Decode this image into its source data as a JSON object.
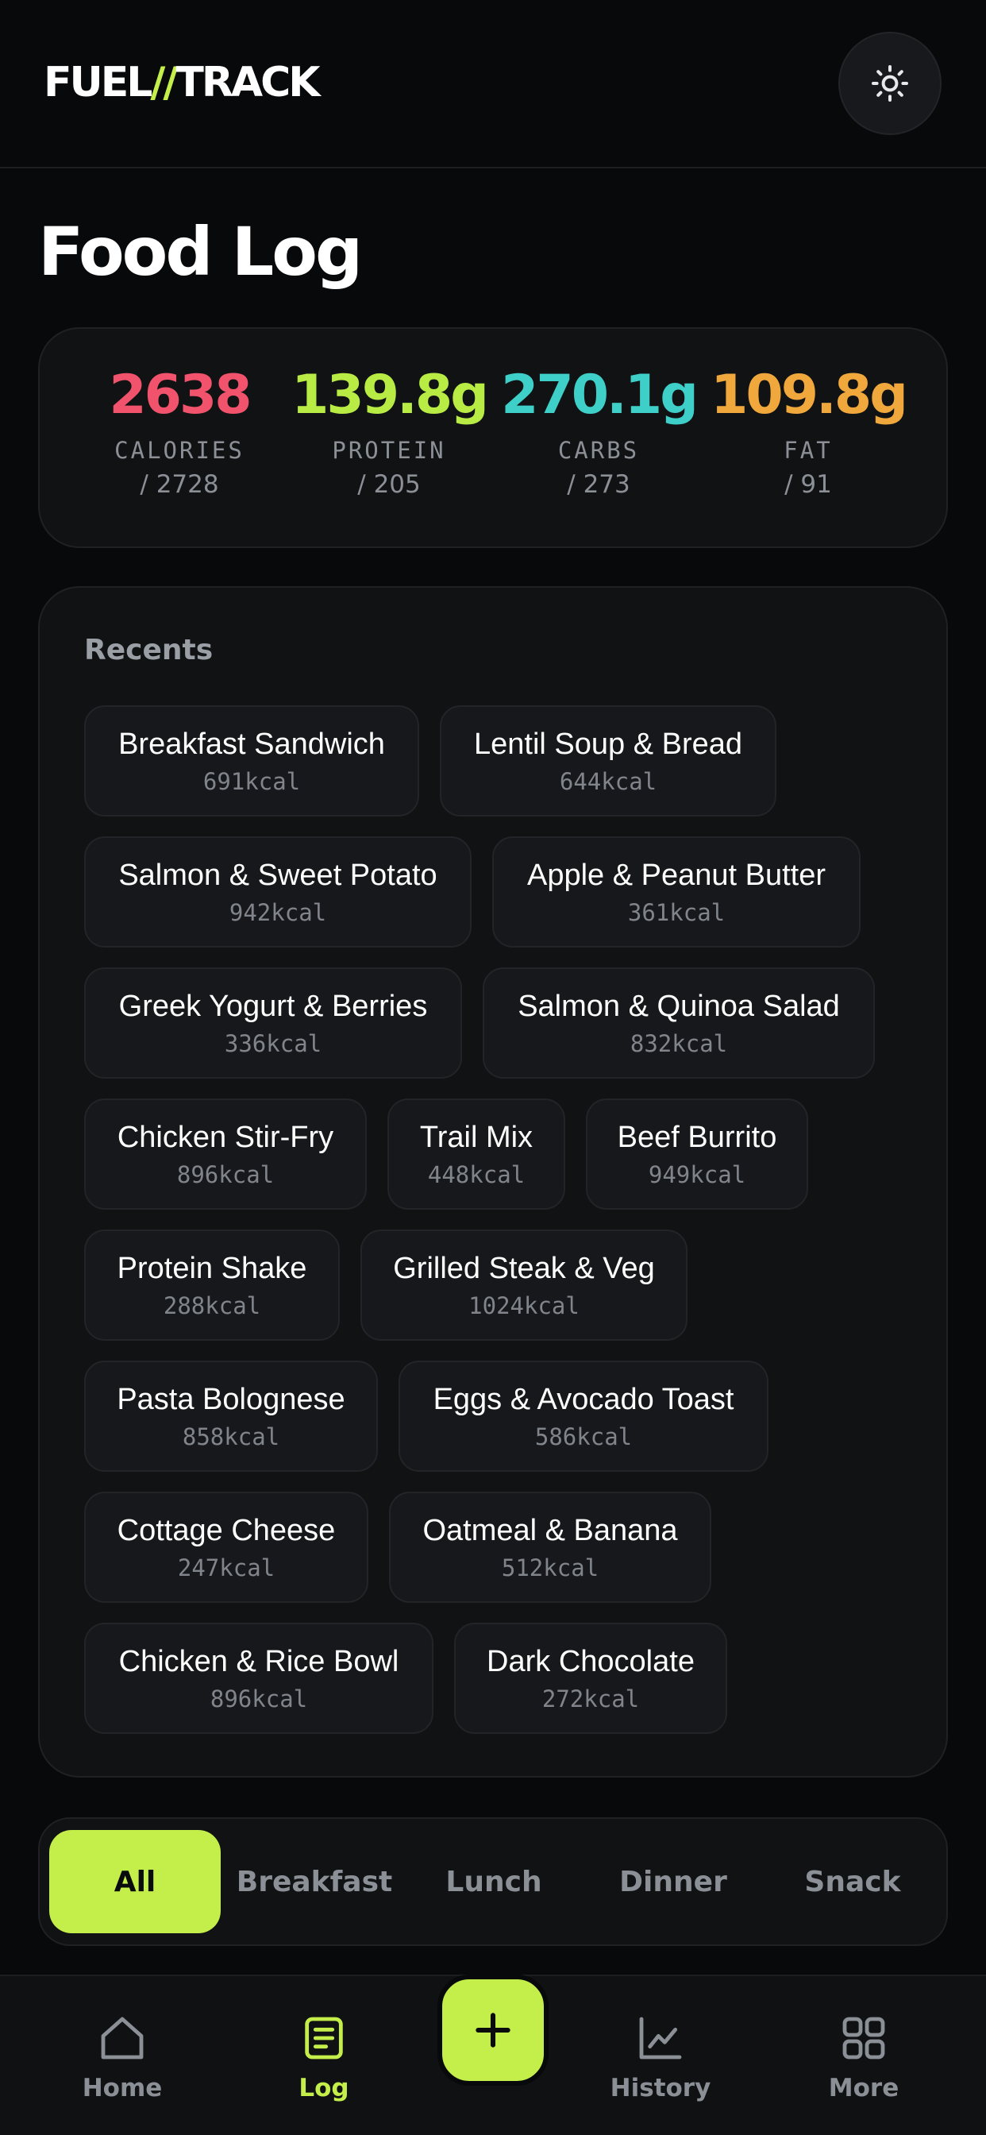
{
  "header": {
    "logo_left": "FUEL",
    "logo_slash": "//",
    "logo_right": "TRACK",
    "theme_icon": "sun-icon"
  },
  "page_title": "Food Log",
  "summary": [
    {
      "value": "2638",
      "label": "CALORIES",
      "goal": "/ 2728",
      "color": "#f0536b"
    },
    {
      "value": "139.8g",
      "label": "PROTEIN",
      "goal": "/ 205",
      "color": "#b8ec45"
    },
    {
      "value": "270.1g",
      "label": "CARBS",
      "goal": "/ 273",
      "color": "#3ed0c8"
    },
    {
      "value": "109.8g",
      "label": "FAT",
      "goal": "/ 91",
      "color": "#f0a73c"
    }
  ],
  "recents": {
    "title": "Recents",
    "items": [
      {
        "name": "Breakfast Sandwich",
        "kcal": "691kcal"
      },
      {
        "name": "Lentil Soup & Bread",
        "kcal": "644kcal"
      },
      {
        "name": "Salmon & Sweet Potato",
        "kcal": "942kcal"
      },
      {
        "name": "Apple & Peanut Butter",
        "kcal": "361kcal"
      },
      {
        "name": "Greek Yogurt & Berries",
        "kcal": "336kcal"
      },
      {
        "name": "Salmon & Quinoa Salad",
        "kcal": "832kcal"
      },
      {
        "name": "Chicken Stir-Fry",
        "kcal": "896kcal"
      },
      {
        "name": "Trail Mix",
        "kcal": "448kcal"
      },
      {
        "name": "Beef Burrito",
        "kcal": "949kcal"
      },
      {
        "name": "Protein Shake",
        "kcal": "288kcal"
      },
      {
        "name": "Grilled Steak & Veg",
        "kcal": "1024kcal"
      },
      {
        "name": "Pasta Bolognese",
        "kcal": "858kcal"
      },
      {
        "name": "Eggs & Avocado Toast",
        "kcal": "586kcal"
      },
      {
        "name": "Cottage Cheese",
        "kcal": "247kcal"
      },
      {
        "name": "Oatmeal & Banana",
        "kcal": "512kcal"
      },
      {
        "name": "Chicken & Rice Bowl",
        "kcal": "896kcal"
      },
      {
        "name": "Dark Chocolate",
        "kcal": "272kcal"
      }
    ]
  },
  "meal_tabs": [
    {
      "label": "All",
      "active": true
    },
    {
      "label": "Breakfast",
      "active": false
    },
    {
      "label": "Lunch",
      "active": false
    },
    {
      "label": "Dinner",
      "active": false
    },
    {
      "label": "Snack",
      "active": false
    }
  ],
  "nav": {
    "home": "Home",
    "log": "Log",
    "history": "History",
    "more": "More",
    "add_icon": "plus-icon"
  },
  "colors": {
    "accent": "#c4ef4a",
    "background": "#08090a",
    "card": "#111214"
  }
}
